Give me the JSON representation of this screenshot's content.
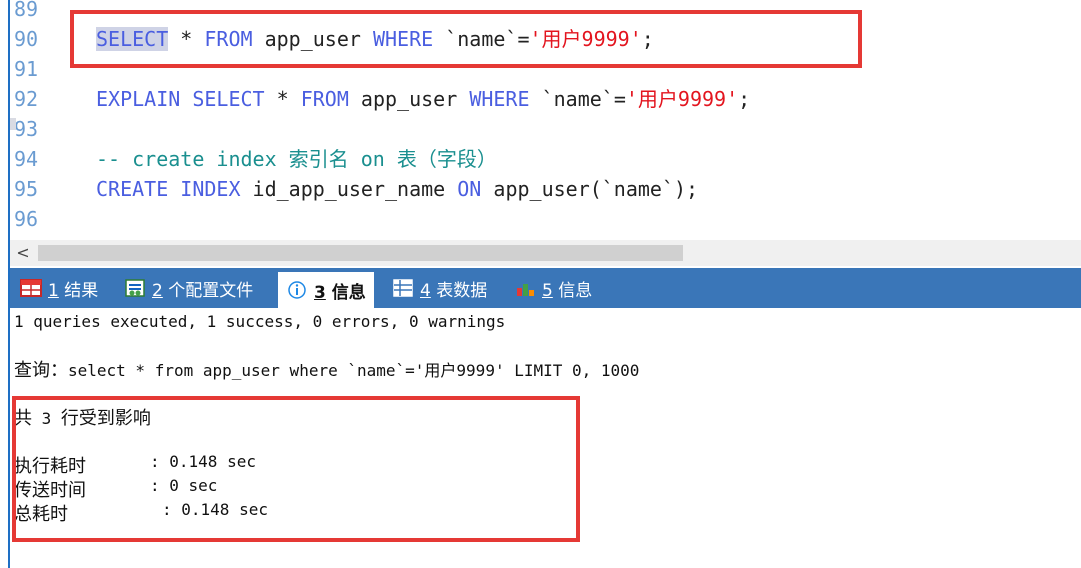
{
  "editor": {
    "line_numbers": [
      "89",
      "90",
      "91",
      "92",
      "93",
      "94",
      "95",
      "96"
    ],
    "line90": {
      "kw1": "SELECT",
      "star": " * ",
      "kw2": "FROM",
      "t1": " app_user ",
      "kw3": "WHERE",
      "t2": " `name`=",
      "str": "'用户9999'",
      "end": ";"
    },
    "line92": {
      "kw1": "EXPLAIN",
      "sp": " ",
      "kw2": "SELECT",
      "star": " * ",
      "kw3": "FROM",
      "t1": " app_user ",
      "kw4": "WHERE",
      "t2": " `name`=",
      "str": "'用户9999'",
      "end": ";"
    },
    "line94": {
      "comment": "-- create index 索引名 on 表（字段）"
    },
    "line95": {
      "kw1": "CREATE",
      "sp": " ",
      "kw2": "INDEX",
      "t1": " id_app_user_name ",
      "kw3": "ON",
      "t2": " app_user(`name`);"
    }
  },
  "scrollbar": {
    "left_arrow": "<"
  },
  "tabs": [
    {
      "num": "1",
      "label": "结果",
      "icon": "table-red-icon"
    },
    {
      "num": "2",
      "label": "个配置文件",
      "icon": "profile-icon"
    },
    {
      "num": "3",
      "label": "信息",
      "icon": "info-icon"
    },
    {
      "num": "4",
      "label": "表数据",
      "icon": "grid-icon"
    },
    {
      "num": "5",
      "label": "信息",
      "icon": "chart-icon"
    }
  ],
  "output": {
    "summary": "1 queries executed, 1 success, 0 errors, 0 warnings",
    "query_label": "查询：",
    "query_text": "select * from app_user where `name`='用户9999' LIMIT 0, 1000",
    "affected_a": "共",
    "affected_num": " 3 ",
    "affected_b": "行受到影响",
    "exec_label": "执行耗时",
    "exec_value": ": 0.148 sec",
    "transfer_label": "传送时间",
    "transfer_value": ": 0 sec",
    "total_label": "总耗时",
    "total_value": ": 0.148 sec"
  },
  "colors": {
    "highlight_box": "#e53935",
    "tabbar": "#3a76b8",
    "keyword": "#4a5ee0",
    "string": "#e3141e",
    "comment": "#1a8f8f"
  }
}
